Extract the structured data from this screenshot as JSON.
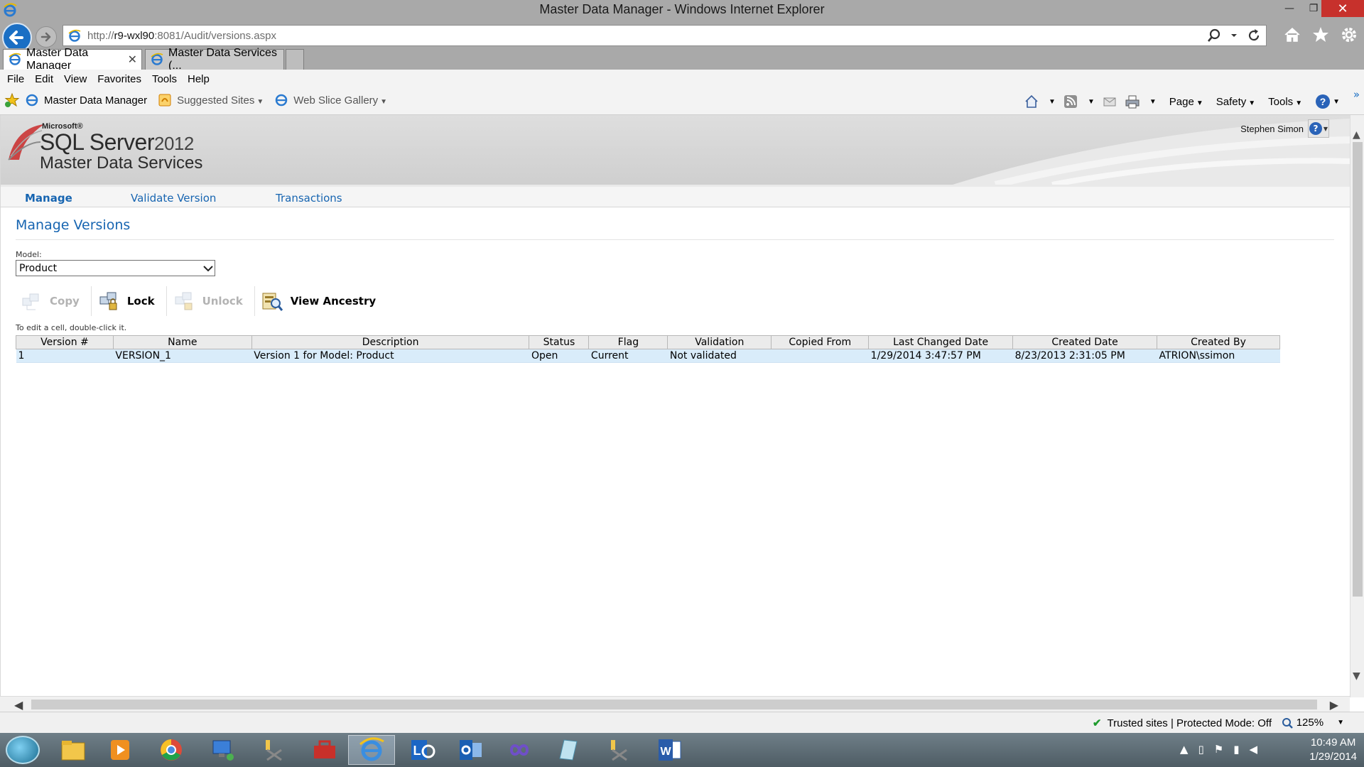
{
  "window": {
    "title": "Master Data Manager - Windows Internet Explorer",
    "minimize": "—",
    "maximize": "❐",
    "close": "✕"
  },
  "address": {
    "scheme": "http://",
    "host": "r9-wxl90",
    "rest": ":8081/Audit/versions.aspx"
  },
  "tabs": [
    {
      "label": "Master Data Manager",
      "close": "✕",
      "active": true
    },
    {
      "label": "Master Data Services (...",
      "active": false
    }
  ],
  "menu": [
    "File",
    "Edit",
    "View",
    "Favorites",
    "Tools",
    "Help"
  ],
  "favorites": {
    "items": [
      "Master Data Manager",
      "Suggested Sites",
      "Web Slice Gallery"
    ]
  },
  "commands": {
    "page": "Page",
    "safety": "Safety",
    "tools": "Tools",
    "overflow": "»"
  },
  "mds": {
    "microsoft": "Microsoft®",
    "sql": "SQL Server",
    "year": "2012",
    "product": "Master Data Services",
    "user": "Stephen Simon"
  },
  "subnav": {
    "manage": "Manage",
    "validate": "Validate Version",
    "transactions": "Transactions"
  },
  "page": {
    "title": "Manage Versions",
    "model_label": "Model:",
    "model_value": "Product",
    "hint": "To edit a cell, double-click it."
  },
  "toolbar": {
    "copy": "Copy",
    "lock": "Lock",
    "unlock": "Unlock",
    "view_ancestry": "View Ancestry"
  },
  "grid": {
    "headers": [
      "Version #",
      "Name",
      "Description",
      "Status",
      "Flag",
      "Validation",
      "Copied From",
      "Last Changed Date",
      "Created Date",
      "Created By"
    ],
    "rows": [
      [
        "1",
        "VERSION_1",
        "Version 1 for Model: Product",
        "Open",
        "Current",
        "Not validated",
        "",
        "1/29/2014 3:47:57 PM",
        "8/23/2013 2:31:05 PM",
        "ATRION\\ssimon"
      ]
    ]
  },
  "status": {
    "zone": "Trusted sites | Protected Mode: Off",
    "zoom": "125%"
  },
  "clock": {
    "time": "10:49 AM",
    "date": "1/29/2014"
  },
  "colors": {
    "accent": "#1765b1",
    "row_selected": "#d9ecfa",
    "close_red": "#c7312c"
  }
}
